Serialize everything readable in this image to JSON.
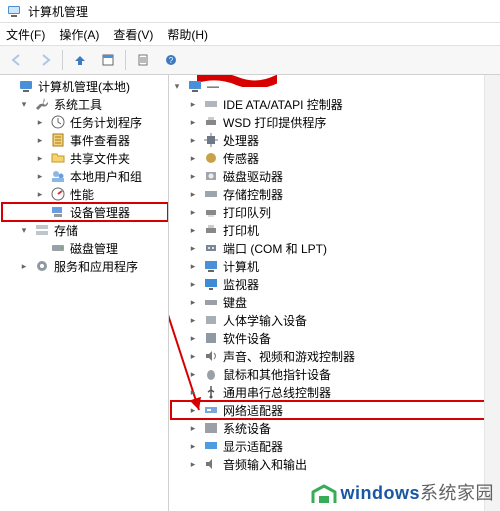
{
  "title": "计算机管理",
  "menu": {
    "file": "文件(F)",
    "action": "操作(A)",
    "view": "查看(V)",
    "help": "帮助(H)"
  },
  "toolbar": {
    "back": "后退",
    "forward": "前进",
    "up": "上一级",
    "props": "属性",
    "refresh": "刷新",
    "help": "帮助"
  },
  "left_tree": {
    "root": "计算机管理(本地)",
    "system_tools": {
      "label": "系统工具",
      "children": [
        "任务计划程序",
        "事件查看器",
        "共享文件夹",
        "本地用户和组",
        "性能",
        "设备管理器"
      ]
    },
    "storage": {
      "label": "存储",
      "children": [
        "磁盘管理"
      ]
    },
    "services": {
      "label": "服务和应用程序"
    }
  },
  "right_tree": {
    "root": "—",
    "items": [
      "IDE ATA/ATAPI 控制器",
      "WSD 打印提供程序",
      "处理器",
      "传感器",
      "磁盘驱动器",
      "存储控制器",
      "打印队列",
      "打印机",
      "端口 (COM 和 LPT)",
      "计算机",
      "监视器",
      "键盘",
      "人体学输入设备",
      "软件设备",
      "声音、视频和游戏控制器",
      "鼠标和其他指针设备",
      "通用串行总线控制器",
      "网络适配器",
      "系统设备",
      "显示适配器",
      "音频输入和输出"
    ]
  },
  "watermark": {
    "text1": "windows",
    "text2": "系统家园"
  }
}
